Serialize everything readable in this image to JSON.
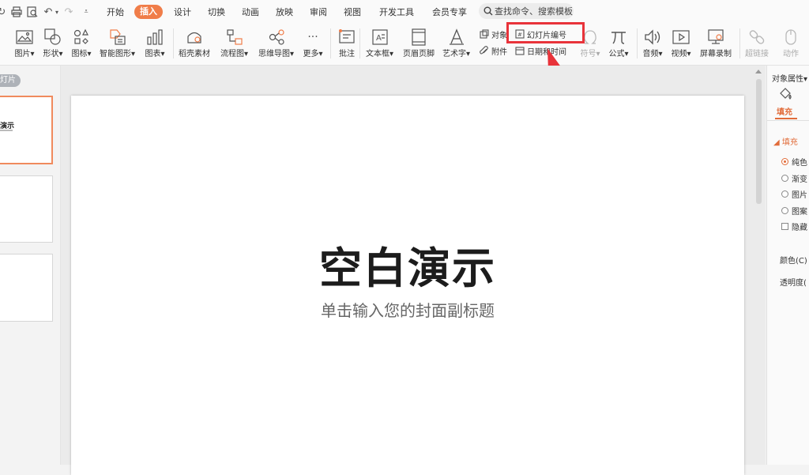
{
  "colors": {
    "accent": "#f07d49",
    "highlight": "#e8333a",
    "fill_tab": "#e16c3a"
  },
  "quick_access": [
    "redo-icon",
    "print-icon",
    "print-preview-icon",
    "undo-icon",
    "undo-dropdown-icon",
    "redo-disabled-icon",
    "customize-dropdown-icon"
  ],
  "menu": {
    "tabs": [
      "开始",
      "插入",
      "设计",
      "切换",
      "动画",
      "放映",
      "审阅",
      "视图",
      "开发工具",
      "会员专享"
    ],
    "active": "插入"
  },
  "search": {
    "text": "查找命令、搜索模板",
    "icon": "search-icon"
  },
  "ribbon": {
    "picture": "图片",
    "shape": "形状",
    "icon": "图标",
    "smartart": "智能图形",
    "chart": "图表",
    "daoke": "稻壳素材",
    "flowchart": "流程图",
    "mindmap": "思维导图",
    "more": "更多",
    "comment": "批注",
    "textbox": "文本框",
    "header_footer": "页眉页脚",
    "wordart": "艺术字",
    "object": "对象",
    "attachment": "附件",
    "slide_number": "幻灯片编号",
    "date_time": "日期和时间",
    "symbol": "符号",
    "formula": "公式",
    "audio": "音频",
    "video": "视频",
    "screen_record": "屏幕录制",
    "hyperlink": "超链接",
    "action": "动作"
  },
  "left_panel": {
    "tab": "灯片",
    "thumb_title": "演示"
  },
  "slide": {
    "title": "空白演示",
    "subtitle": "单击输入您的封面副标题"
  },
  "right_panel": {
    "title": "对象属性",
    "tab": "填充",
    "section": "填充",
    "options": [
      "纯色",
      "渐变",
      "图片",
      "图案"
    ],
    "checkbox": "隐藏",
    "color_label": "颜色(C)",
    "transparency_label": "透明度("
  }
}
